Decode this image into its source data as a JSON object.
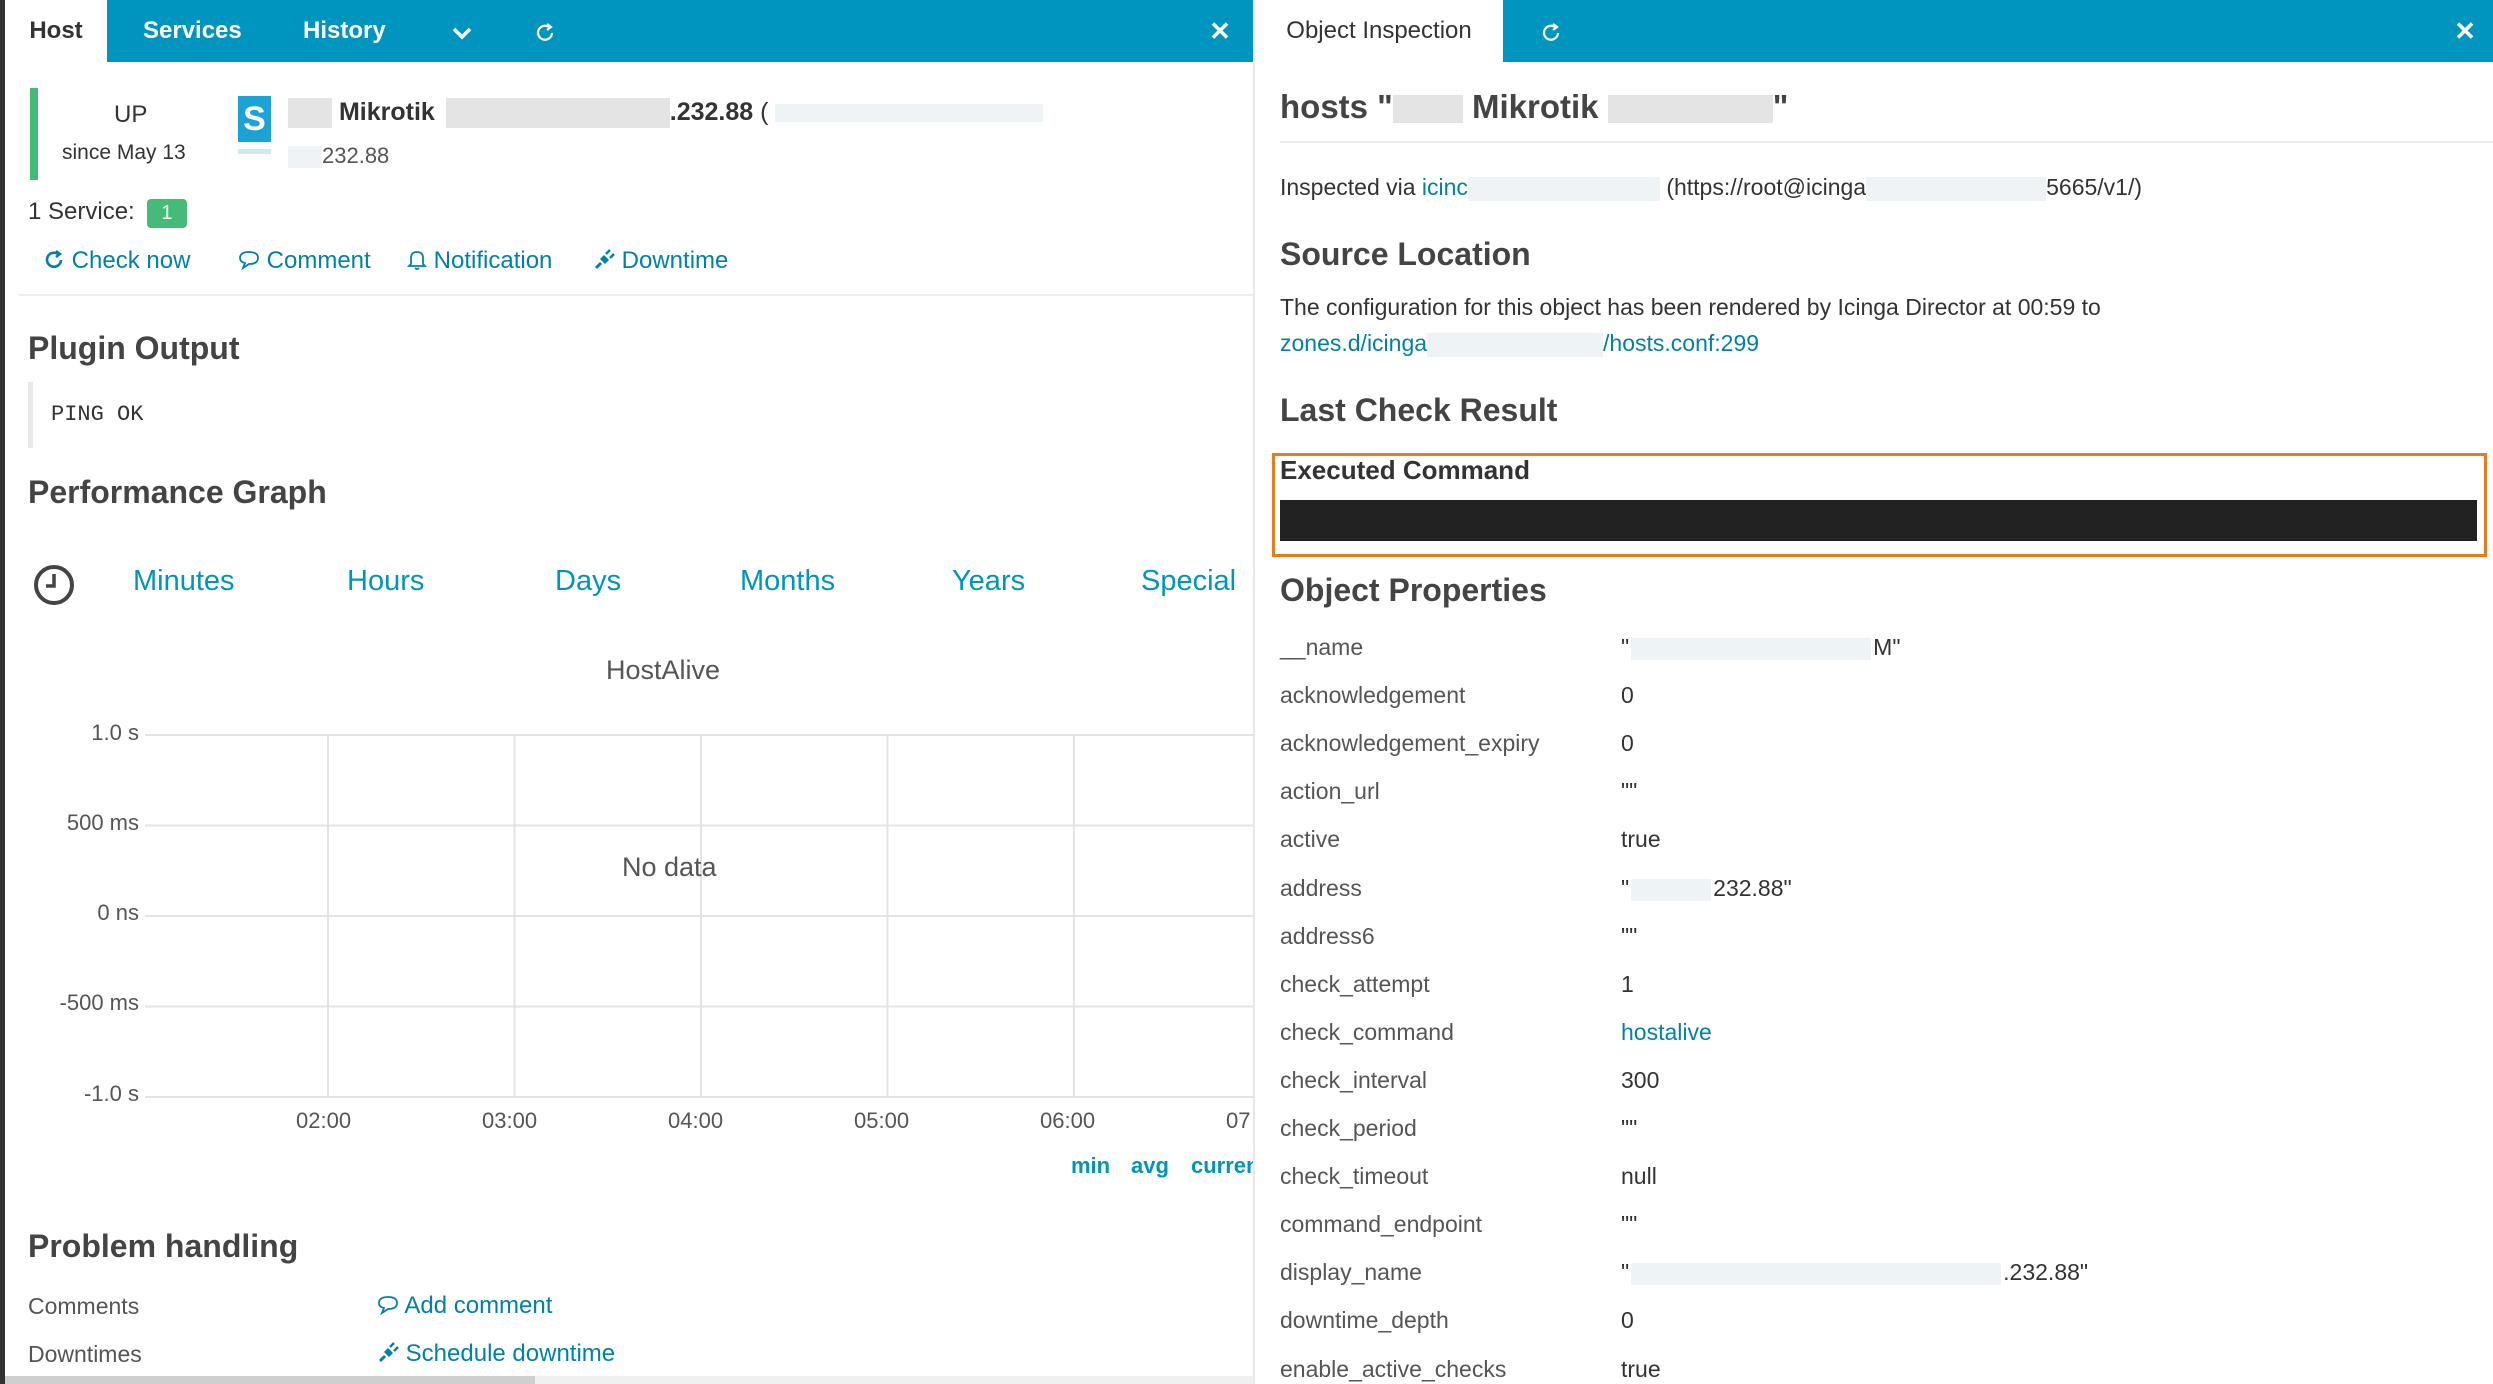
{
  "left": {
    "tabs": {
      "host": "Host",
      "services": "Services",
      "history": "History"
    },
    "icons": {
      "dropdown": "chevron-down-icon",
      "refresh": "refresh-icon",
      "close": "close-icon"
    },
    "host": {
      "state": "UP",
      "since": "since May 13",
      "icon_letter": "S",
      "name": "Mikrotik",
      "ip_fragment": ".232.88",
      "paren": "(",
      "address_fragment": "232.88"
    },
    "services": {
      "label": "1 Service:",
      "count": "1"
    },
    "actions": {
      "check_now": "Check now",
      "comment": "Comment",
      "notification": "Notification",
      "downtime": "Downtime"
    },
    "plugin_output": {
      "title": "Plugin Output",
      "text": "PING OK"
    },
    "perf": {
      "title": "Performance Graph",
      "tabs": [
        "Minutes",
        "Hours",
        "Days",
        "Months",
        "Years",
        "Special"
      ]
    },
    "chart_data": {
      "type": "line",
      "title": "HostAlive",
      "annotation": "No data",
      "y_ticks": [
        "1.0 s",
        "500 ms",
        "0 ns",
        "-500 ms",
        "-1.0 s"
      ],
      "x_ticks": [
        "02:00",
        "03:00",
        "04:00",
        "05:00",
        "06:00",
        "07"
      ],
      "series": [],
      "legend": [
        "min",
        "avg",
        "curren"
      ],
      "grid": true
    },
    "problem": {
      "title": "Problem handling",
      "comments_label": "Comments",
      "add_comment": "Add comment",
      "downtimes_label": "Downtimes",
      "schedule_downtime": "Schedule downtime"
    },
    "colors": {
      "up": "#44bb77",
      "accent": "#0095bf",
      "badge": "#44bb77"
    }
  },
  "right": {
    "tab": "Object Inspection",
    "title_prefix": "hosts \"",
    "title_name": "Mikrotik",
    "title_suffix": "\"",
    "inspected_prefix": "Inspected via ",
    "inspected_link": "icinc",
    "inspected_url_a": "(https://root@icinga",
    "inspected_url_b": "5665/v1/)",
    "source_title": "Source Location",
    "source_text": "The configuration for this object has been rendered by Icinga Director at 00:59 to",
    "source_link_a": "zones.d/icinga",
    "source_link_b": "/hosts.conf:299",
    "last_check_title": "Last Check Result",
    "executed_command": "Executed Command",
    "properties_title": "Object Properties",
    "properties": [
      {
        "key": "__name",
        "val": "\"",
        "tail": "M\""
      },
      {
        "key": "acknowledgement",
        "val": "0"
      },
      {
        "key": "acknowledgement_expiry",
        "val": "0"
      },
      {
        "key": "action_url",
        "val": "\"\""
      },
      {
        "key": "active",
        "val": "true"
      },
      {
        "key": "address",
        "val": "\"",
        "tail": "232.88\""
      },
      {
        "key": "address6",
        "val": "\"\""
      },
      {
        "key": "check_attempt",
        "val": "1"
      },
      {
        "key": "check_command",
        "val": "hostalive",
        "link": true
      },
      {
        "key": "check_interval",
        "val": "300"
      },
      {
        "key": "check_period",
        "val": "\"\""
      },
      {
        "key": "check_timeout",
        "val": "null"
      },
      {
        "key": "command_endpoint",
        "val": "\"\""
      },
      {
        "key": "display_name",
        "val": "\"",
        "tail": ".232.88\""
      },
      {
        "key": "downtime_depth",
        "val": "0"
      },
      {
        "key": "enable_active_checks",
        "val": "true"
      }
    ],
    "colors": {
      "highlight": "#e87d1e",
      "command_bg": "#222222"
    }
  }
}
